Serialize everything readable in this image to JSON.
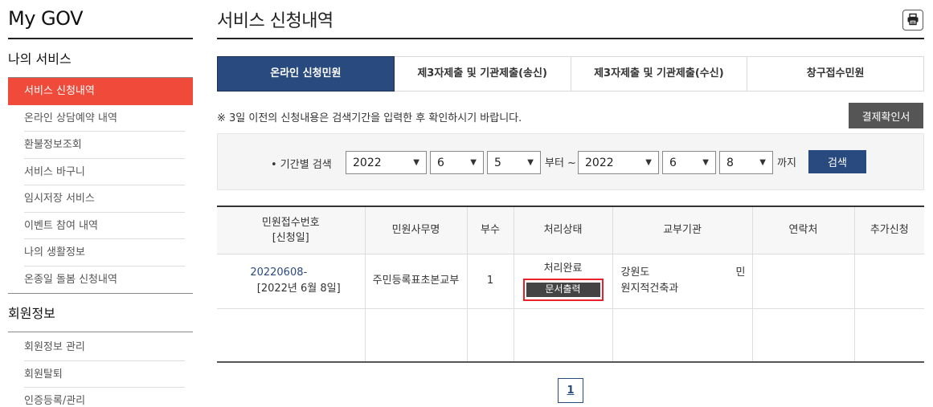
{
  "sidebar": {
    "brand": "My GOV",
    "sections": [
      {
        "title": "나의 서비스",
        "items": [
          {
            "label": "서비스 신청내역",
            "active": true
          },
          {
            "label": "온라인 상담예약 내역"
          },
          {
            "label": "환불정보조회"
          },
          {
            "label": "서비스 바구니"
          },
          {
            "label": "임시저장 서비스"
          },
          {
            "label": "이벤트 참여 내역"
          },
          {
            "label": "나의 생활정보"
          },
          {
            "label": "온종일 돌봄 신청내역"
          }
        ]
      },
      {
        "title": "회원정보",
        "items": [
          {
            "label": "회원정보 관리"
          },
          {
            "label": "회원탈퇴"
          },
          {
            "label": "인증등록/관리"
          }
        ]
      }
    ]
  },
  "header": {
    "title": "서비스 신청내역",
    "print_icon": "printer-icon"
  },
  "tabs": [
    {
      "label": "온라인 신청민원",
      "active": true
    },
    {
      "label": "제3자제출 및 기관제출(송신)"
    },
    {
      "label": "제3자제출 및 기관제출(수신)"
    },
    {
      "label": "창구접수민원"
    }
  ],
  "notice": "※ 3일 이전의 신청내용은 검색기간을 입력한 후 확인하시기 바랍니다.",
  "receipt_button": "결제확인서",
  "search": {
    "label": "• 기간별 검색",
    "from_year": "2022",
    "from_month": "6",
    "from_day": "5",
    "from_text": "부터 ~",
    "to_year": "2022",
    "to_month": "6",
    "to_day": "8",
    "to_text": "까지",
    "button": "검색"
  },
  "table": {
    "headers": [
      "민원접수번호",
      "[신청일]",
      "민원사무명",
      "부수",
      "처리상태",
      "교부기관",
      "연락처",
      "추가신청"
    ],
    "rows": [
      {
        "receipt_no": "20220608-",
        "date": "[2022년 6월 8일]",
        "name": "주민등록표초본교부",
        "count": "1",
        "status": "처리완료",
        "print_button": "문서출력",
        "agency_1": "강원도",
        "agency_2": "민",
        "agency_3": "원지적건축과",
        "contact": "",
        "extra": ""
      }
    ]
  },
  "pagination": {
    "current": "1"
  },
  "colors": {
    "accent_red": "#f04a3a",
    "navy": "#294a7f",
    "highlight_red": "#e8212b"
  }
}
